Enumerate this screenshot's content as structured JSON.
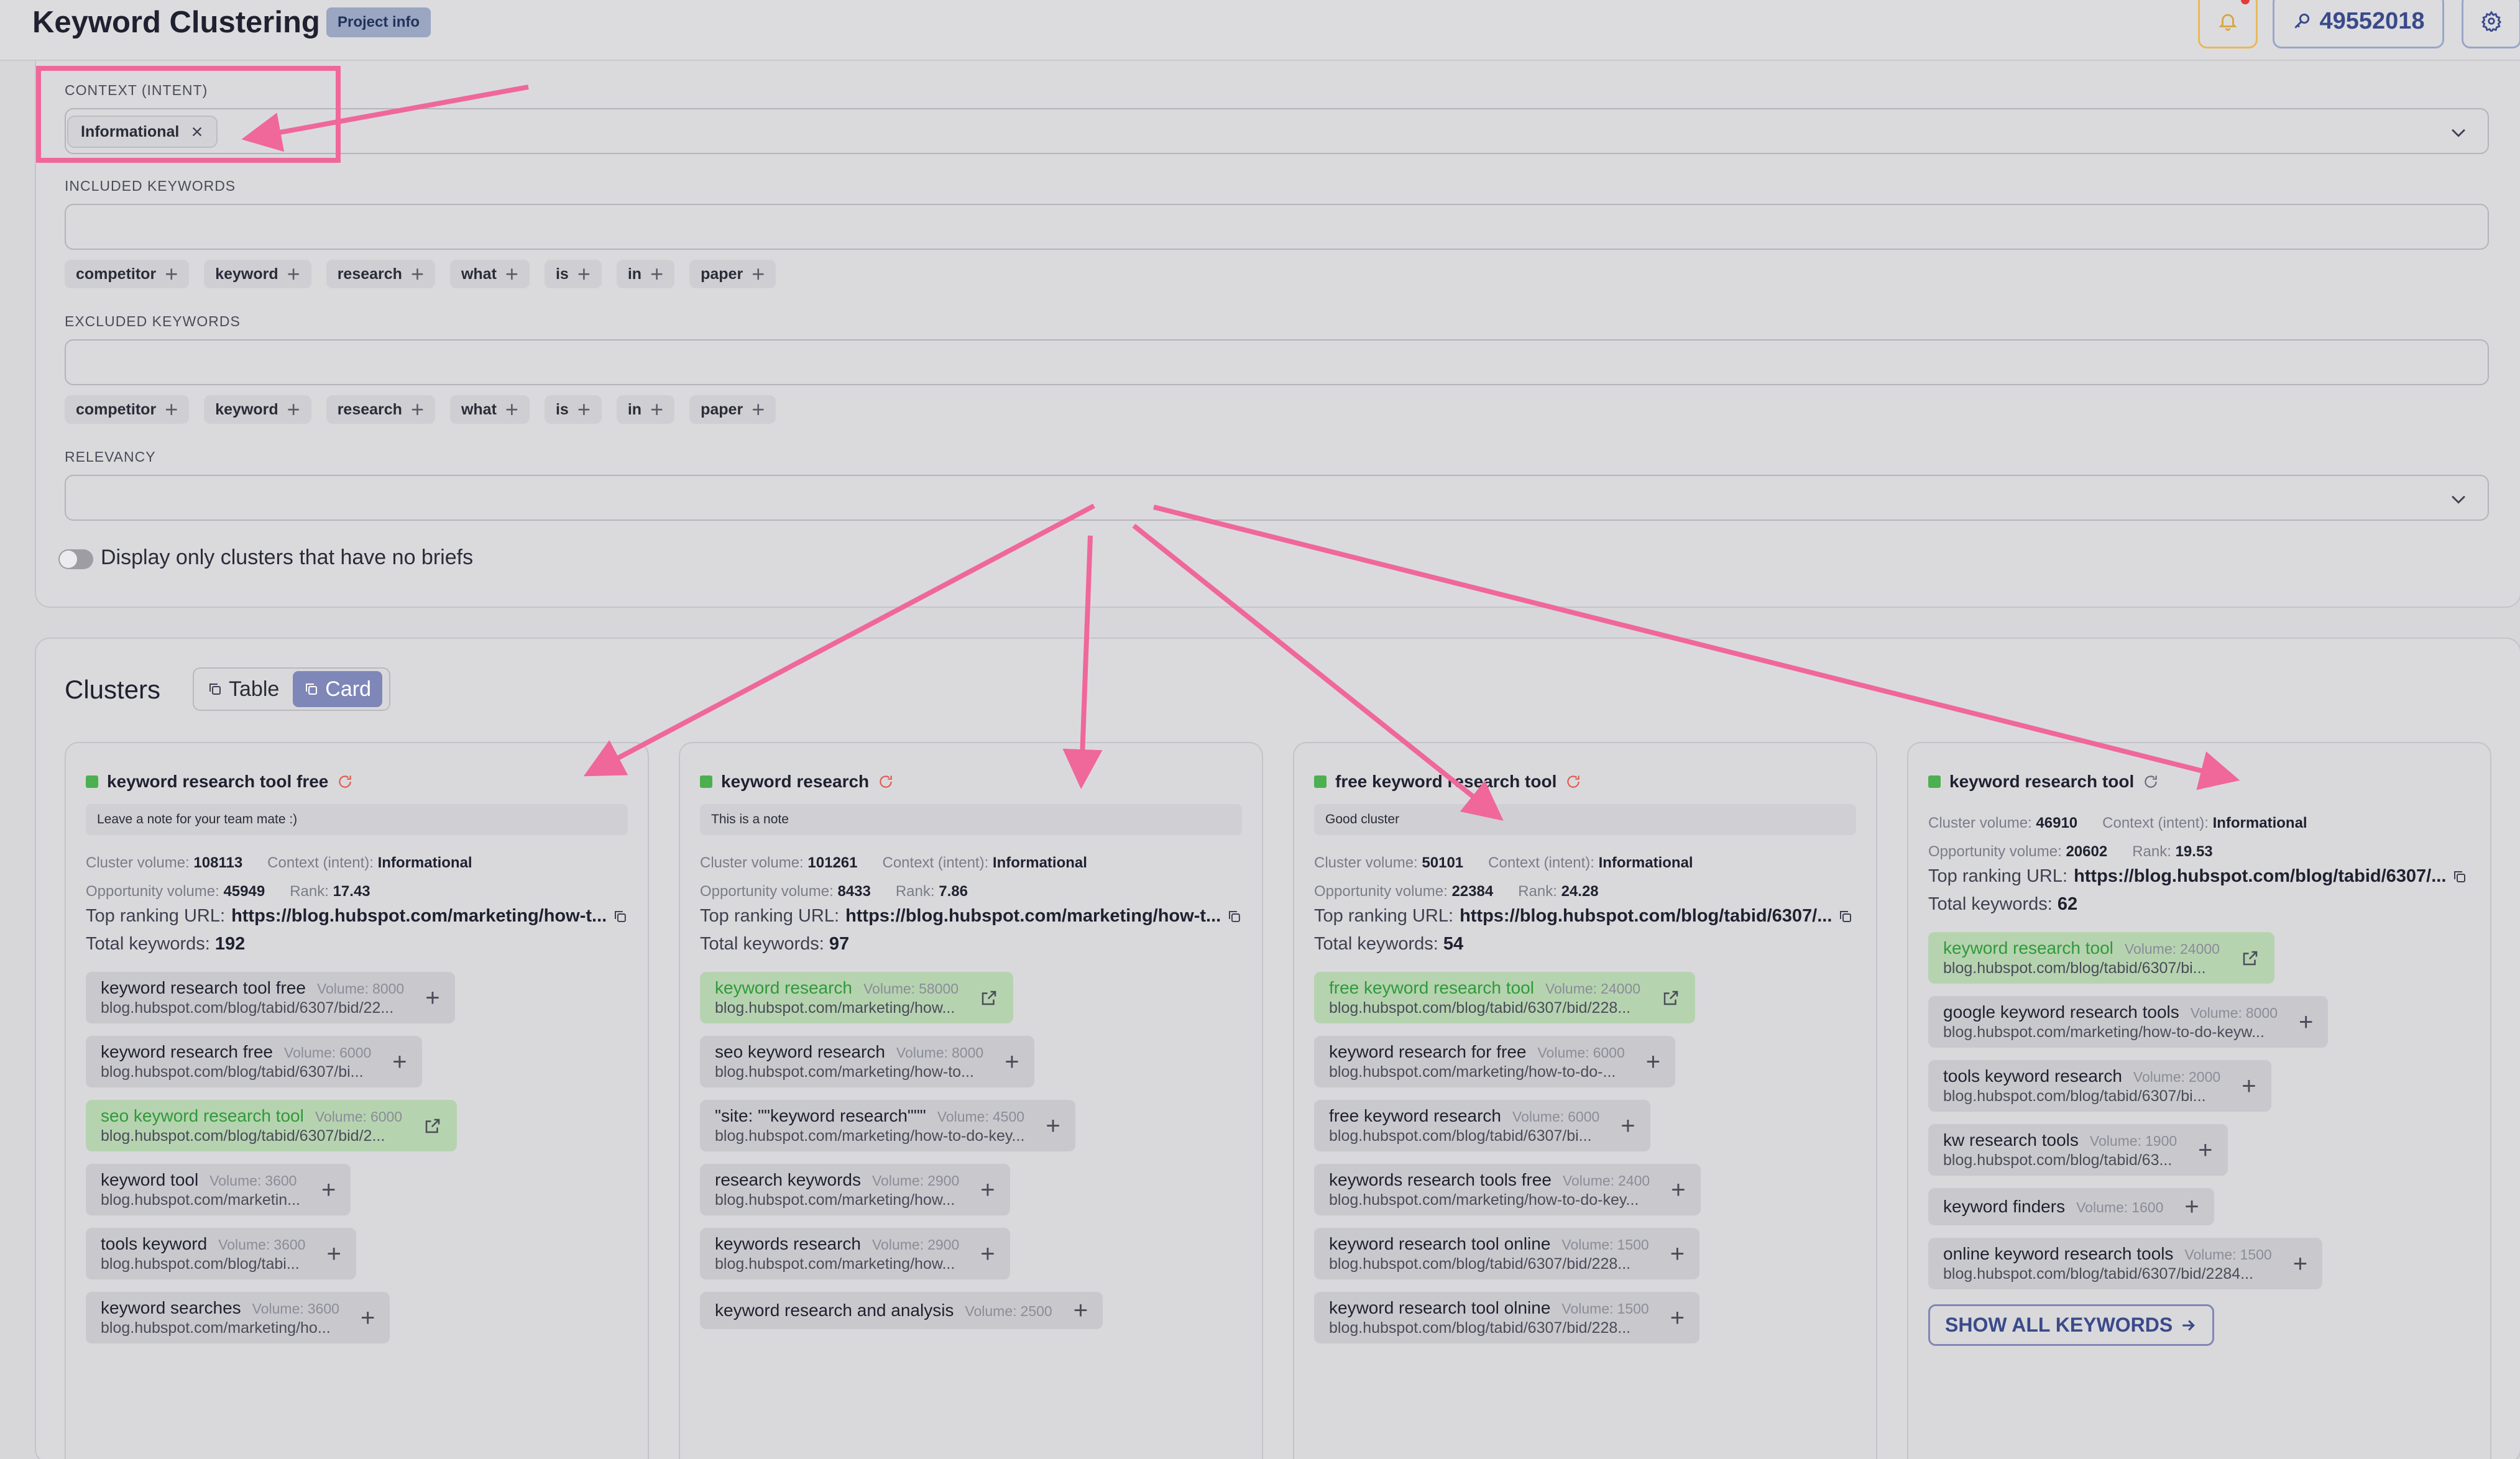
{
  "header": {
    "title": "Keyword Clustering",
    "project_badge": "Project info",
    "credits": "49552018"
  },
  "filters": {
    "context_label": "CONTEXT (INTENT)",
    "context_value": "Informational",
    "included_label": "INCLUDED KEYWORDS",
    "included_chips": [
      "competitor",
      "keyword",
      "research",
      "what",
      "is",
      "in",
      "paper"
    ],
    "excluded_label": "EXCLUDED KEYWORDS",
    "excluded_chips": [
      "competitor",
      "keyword",
      "research",
      "what",
      "is",
      "in",
      "paper"
    ],
    "relevancy_label": "RELEVANCY",
    "toggle_label": "Display only clusters that have no briefs"
  },
  "clusters": {
    "title": "Clusters",
    "view_table": "Table",
    "view_card": "Card",
    "labels": {
      "cluster_volume": "Cluster volume:",
      "context": "Context (intent):",
      "opportunity": "Opportunity volume:",
      "rank": "Rank:",
      "top_url": "Top ranking URL:",
      "total": "Total keywords:",
      "volume": "Volume:"
    },
    "show_all": "SHOW ALL KEYWORDS",
    "cards": [
      {
        "name": "keyword research tool free",
        "note": "Leave a note for your team mate :)",
        "cluster_volume": "108113",
        "context": "Informational",
        "opportunity_volume": "45949",
        "rank": "17.43",
        "top_url": "https://blog.hubspot.com/marketing/how-t...",
        "total_keywords": "192",
        "keywords": [
          {
            "name": "keyword research tool free",
            "volume": "8000",
            "url": "blog.hubspot.com/blog/tabid/6307/bid/22...",
            "green": false
          },
          {
            "name": "keyword research free",
            "volume": "6000",
            "url": "blog.hubspot.com/blog/tabid/6307/bi...",
            "green": false
          },
          {
            "name": "seo keyword research tool",
            "volume": "6000",
            "url": "blog.hubspot.com/blog/tabid/6307/bid/2...",
            "green": true
          },
          {
            "name": "keyword tool",
            "volume": "3600",
            "url": "blog.hubspot.com/marketin...",
            "green": false
          },
          {
            "name": "tools keyword",
            "volume": "3600",
            "url": "blog.hubspot.com/blog/tabi...",
            "green": false
          },
          {
            "name": "keyword searches",
            "volume": "3600",
            "url": "blog.hubspot.com/marketing/ho...",
            "green": false
          }
        ]
      },
      {
        "name": "keyword research",
        "note": "This is a note",
        "cluster_volume": "101261",
        "context": "Informational",
        "opportunity_volume": "8433",
        "rank": "7.86",
        "top_url": "https://blog.hubspot.com/marketing/how-t...",
        "total_keywords": "97",
        "keywords": [
          {
            "name": "keyword research",
            "volume": "58000",
            "url": "blog.hubspot.com/marketing/how...",
            "green": true
          },
          {
            "name": "seo keyword research",
            "volume": "8000",
            "url": "blog.hubspot.com/marketing/how-to...",
            "green": false
          },
          {
            "name": "\"site: \"\"keyword research\"\"\"",
            "volume": "4500",
            "url": "blog.hubspot.com/marketing/how-to-do-key...",
            "green": false
          },
          {
            "name": "research keywords",
            "volume": "2900",
            "url": "blog.hubspot.com/marketing/how...",
            "green": false
          },
          {
            "name": "keywords research",
            "volume": "2900",
            "url": "blog.hubspot.com/marketing/how...",
            "green": false
          },
          {
            "name": "keyword research and analysis",
            "volume": "2500",
            "url": "",
            "green": false
          }
        ]
      },
      {
        "name": "free keyword research tool",
        "note": "Good cluster",
        "cluster_volume": "50101",
        "context": "Informational",
        "opportunity_volume": "22384",
        "rank": "24.28",
        "top_url": "https://blog.hubspot.com/blog/tabid/6307/...",
        "total_keywords": "54",
        "keywords": [
          {
            "name": "free keyword research tool",
            "volume": "24000",
            "url": "blog.hubspot.com/blog/tabid/6307/bid/228...",
            "green": true
          },
          {
            "name": "keyword research for free",
            "volume": "6000",
            "url": "blog.hubspot.com/marketing/how-to-do-...",
            "green": false
          },
          {
            "name": "free keyword research",
            "volume": "6000",
            "url": "blog.hubspot.com/blog/tabid/6307/bi...",
            "green": false
          },
          {
            "name": "keywords research tools free",
            "volume": "2400",
            "url": "blog.hubspot.com/marketing/how-to-do-key...",
            "green": false
          },
          {
            "name": "keyword research tool online",
            "volume": "1500",
            "url": "blog.hubspot.com/blog/tabid/6307/bid/228...",
            "green": false
          },
          {
            "name": "keyword research tool olnine",
            "volume": "1500",
            "url": "blog.hubspot.com/blog/tabid/6307/bid/228...",
            "green": false
          }
        ]
      },
      {
        "name": "keyword research tool",
        "note": "",
        "cluster_volume": "46910",
        "context": "Informational",
        "opportunity_volume": "20602",
        "rank": "19.53",
        "top_url": "https://blog.hubspot.com/blog/tabid/6307/...",
        "total_keywords": "62",
        "keywords": [
          {
            "name": "keyword research tool",
            "volume": "24000",
            "url": "blog.hubspot.com/blog/tabid/6307/bi...",
            "green": true
          },
          {
            "name": "google keyword research tools",
            "volume": "8000",
            "url": "blog.hubspot.com/marketing/how-to-do-keyw...",
            "green": false
          },
          {
            "name": "tools keyword research",
            "volume": "2000",
            "url": "blog.hubspot.com/blog/tabid/6307/bi...",
            "green": false
          },
          {
            "name": "kw research tools",
            "volume": "1900",
            "url": "blog.hubspot.com/blog/tabid/63...",
            "green": false
          },
          {
            "name": "keyword finders",
            "volume": "1600",
            "url": "",
            "green": false
          },
          {
            "name": "online keyword research tools",
            "volume": "1500",
            "url": "blog.hubspot.com/blog/tabid/6307/bid/2284...",
            "green": false
          }
        ]
      }
    ]
  },
  "colors": {
    "accent": "#7f87b8",
    "annotation_arrow": "#f0679a",
    "green_keyword": "#2f9a3a",
    "status_green": "#4caf50"
  }
}
